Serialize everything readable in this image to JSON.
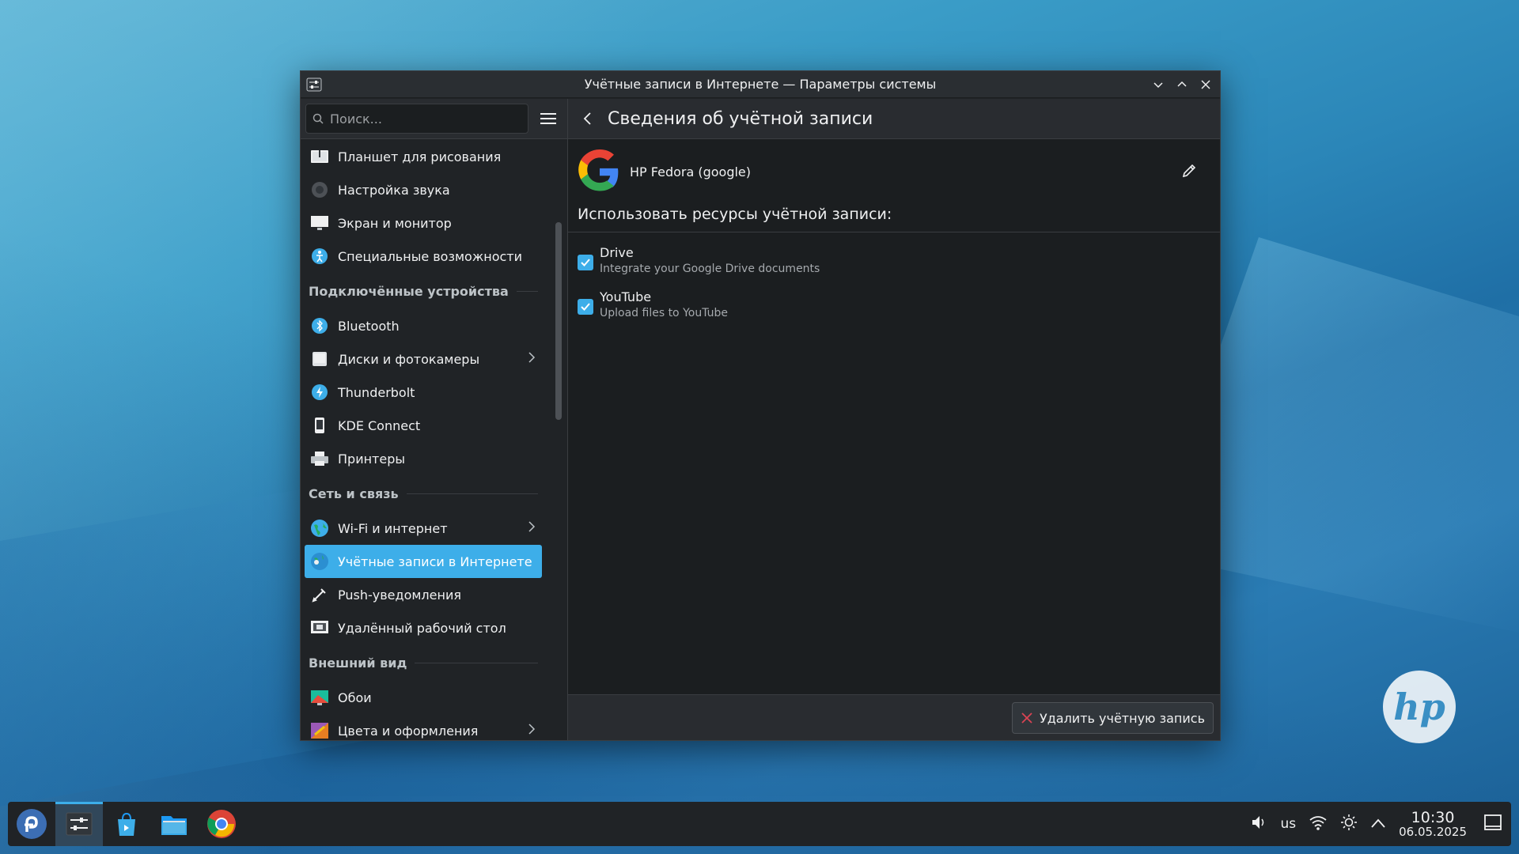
{
  "window": {
    "title": "Учётные записи в Интернете — Параметры системы"
  },
  "sidebar": {
    "search_placeholder": "Поиск...",
    "items_top": [
      {
        "label": "Планшет для рисования",
        "icon": "tablet-icon"
      },
      {
        "label": "Настройка звука",
        "icon": "speaker-icon"
      },
      {
        "label": "Экран и монитор",
        "icon": "monitor-icon"
      },
      {
        "label": "Специальные возможности",
        "icon": "accessibility-icon"
      }
    ],
    "section_devices": "Подключённые устройства",
    "items_devices": [
      {
        "label": "Bluetooth",
        "icon": "bluetooth-icon"
      },
      {
        "label": "Диски и фотокамеры",
        "icon": "drive-icon"
      },
      {
        "label": "Thunderbolt",
        "icon": "thunderbolt-icon"
      },
      {
        "label": "KDE Connect",
        "icon": "phone-icon"
      },
      {
        "label": "Принтеры",
        "icon": "printer-icon"
      }
    ],
    "section_network": "Сеть и связь",
    "items_network": [
      {
        "label": "Wi-Fi и интернет",
        "icon": "globe-icon"
      },
      {
        "label": "Учётные записи в Интернете",
        "icon": "online-accounts-icon"
      },
      {
        "label": "Push-уведомления",
        "icon": "push-icon"
      },
      {
        "label": "Удалённый рабочий стол",
        "icon": "remote-desktop-icon"
      }
    ],
    "section_appearance": "Внешний вид",
    "items_appearance": [
      {
        "label": "Обои",
        "icon": "wallpaper-icon"
      },
      {
        "label": "Цвета и оформления",
        "icon": "colors-icon"
      }
    ]
  },
  "main": {
    "title": "Сведения об учётной записи",
    "account_name": "HP Fedora (google)",
    "use_label": "Использовать ресурсы учётной записи:",
    "services": [
      {
        "title": "Drive",
        "description": "Integrate your Google Drive documents",
        "checked": true
      },
      {
        "title": "YouTube",
        "description": "Upload files to YouTube",
        "checked": true
      }
    ],
    "delete_button": "Удалить учётную запись"
  },
  "taskbar": {
    "keyboard_layout": "us",
    "time": "10:30",
    "date": "06.05.2025"
  },
  "colors": {
    "accent": "#3daee9",
    "window_bg": "#202326"
  }
}
